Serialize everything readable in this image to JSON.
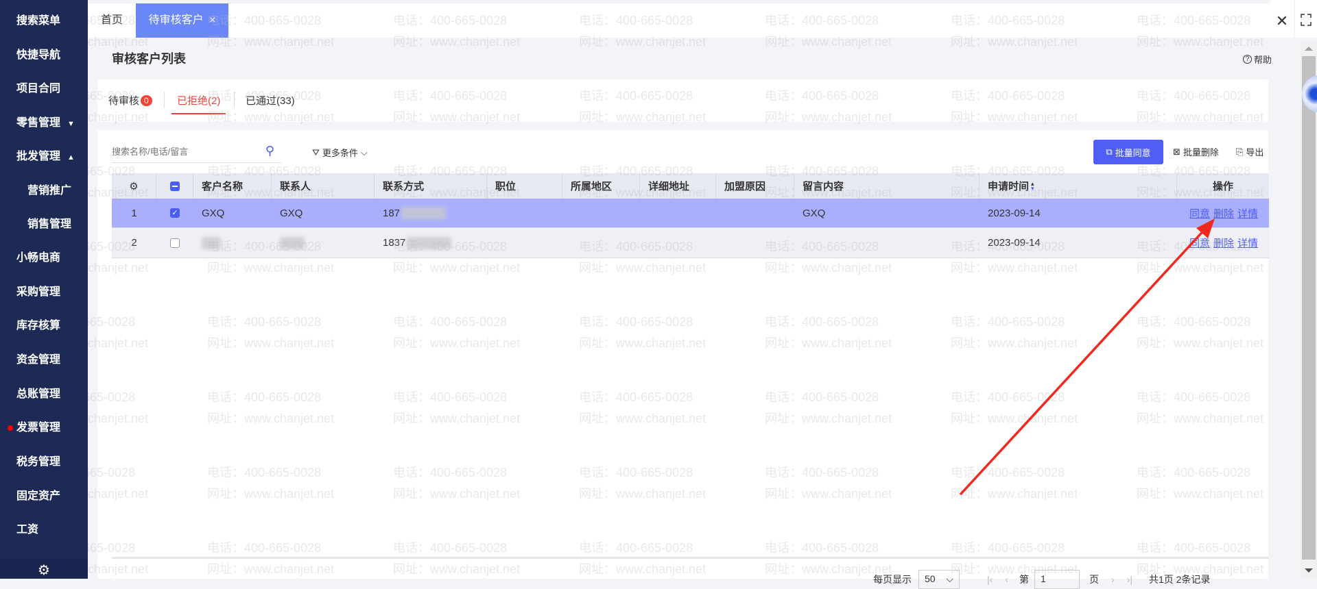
{
  "sidebar": {
    "items": [
      {
        "label": "搜索菜单"
      },
      {
        "label": "快捷导航"
      },
      {
        "label": "项目合同"
      },
      {
        "label": "零售管理",
        "caret": "▼"
      },
      {
        "label": "批发管理",
        "caret": "▲"
      },
      {
        "label": "营销推广",
        "sub": true
      },
      {
        "label": "销售管理",
        "sub": true
      },
      {
        "label": "小畅电商"
      },
      {
        "label": "采购管理"
      },
      {
        "label": "库存核算"
      },
      {
        "label": "资金管理"
      },
      {
        "label": "总账管理"
      },
      {
        "label": "发票管理",
        "dot": true
      },
      {
        "label": "税务管理"
      },
      {
        "label": "固定资产"
      },
      {
        "label": "工资"
      }
    ]
  },
  "tabs": {
    "home": "首页",
    "active": "待审核客户",
    "close": "×"
  },
  "page": {
    "title": "审核客户列表",
    "help": "帮助"
  },
  "status_tabs": [
    {
      "label": "待审核",
      "badge": "0"
    },
    {
      "label": "已拒绝(2)",
      "active": true
    },
    {
      "label": "已通过(33)"
    }
  ],
  "toolbar": {
    "search_placeholder": "搜索名称/电话/留言",
    "more": "更多条件",
    "batch_agree": "批量同意",
    "batch_delete": "批量删除",
    "export": "导出"
  },
  "table": {
    "headers": [
      "客户名称",
      "联系人",
      "联系方式",
      "职位",
      "所属地区",
      "详细地址",
      "加盟原因",
      "留言内容",
      "申请时间",
      "操作"
    ],
    "rows": [
      {
        "no": "1",
        "checked": true,
        "name": "GXQ",
        "contact": "GXQ",
        "phone": "187",
        "message": "GXQ",
        "date": "2023-09-14"
      },
      {
        "no": "2",
        "checked": false,
        "name": "",
        "contact": "",
        "phone": "1837",
        "message": "",
        "date": "2023-09-14"
      }
    ],
    "actions": [
      "同意",
      "删除",
      "详情"
    ]
  },
  "pagination": {
    "per_page_label": "每页显示",
    "per_page": "50",
    "page_prefix": "第",
    "page": "1",
    "page_suffix": "页",
    "summary": "共1页 2条记录"
  },
  "watermark": {
    "phone": "电话：400-665-0028",
    "url": "网址：www.chanjet.net"
  },
  "colors": {
    "sidebar": "#1c2a55",
    "accent": "#4a5df0",
    "active_tab": "#6a87f8",
    "selected_row": "#a9affd",
    "reject_tab": "#e8413a",
    "arrow": "#f0281e"
  }
}
